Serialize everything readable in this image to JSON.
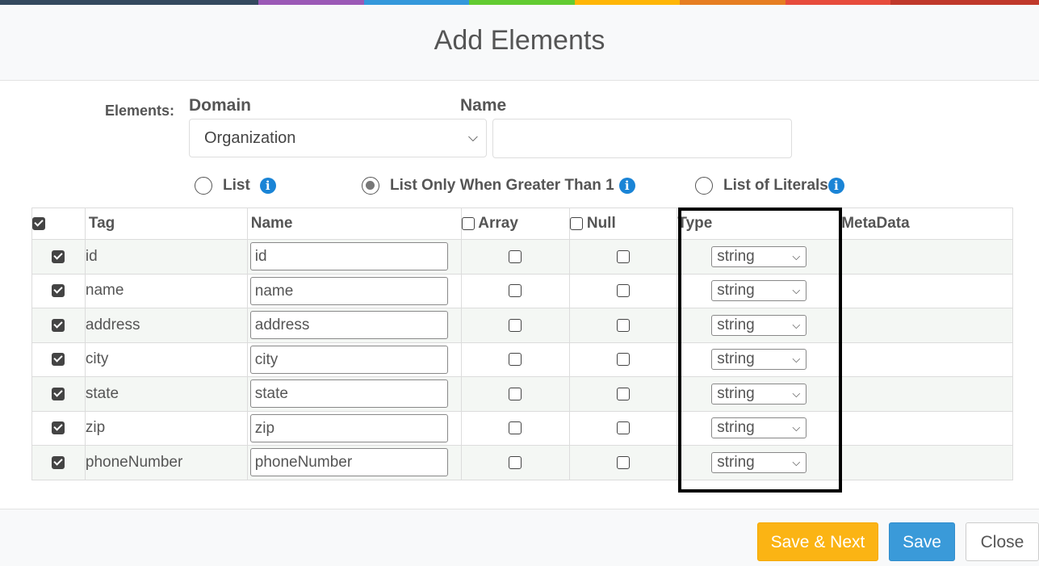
{
  "rainbow_colors": [
    "#34495e",
    "#9b59b6",
    "#3498db",
    "#62cb31",
    "#ffb606",
    "#e67e22",
    "#e74c3c",
    "#c0392b"
  ],
  "header": {
    "title": "Add Elements"
  },
  "form": {
    "elements_label": "Elements:",
    "domain_label": "Domain",
    "name_label": "Name",
    "domain_value": "Organization",
    "name_value": ""
  },
  "radios": {
    "list": "List",
    "list_gt1": "List Only When Greater Than 1",
    "literals": "List of Literals",
    "selected": "list_gt1"
  },
  "table": {
    "headers": {
      "tag": "Tag",
      "name": "Name",
      "array": "Array",
      "null": "Null",
      "type": "Type",
      "metadata": "MetaData"
    },
    "rows": [
      {
        "tag": "id",
        "name": "id",
        "type": "string"
      },
      {
        "tag": "name",
        "name": "name",
        "type": "string"
      },
      {
        "tag": "address",
        "name": "address",
        "type": "string"
      },
      {
        "tag": "city",
        "name": "city",
        "type": "string"
      },
      {
        "tag": "state",
        "name": "state",
        "type": "string"
      },
      {
        "tag": "zip",
        "name": "zip",
        "type": "string"
      },
      {
        "tag": "phoneNumber",
        "name": "phoneNumber",
        "type": "string"
      }
    ]
  },
  "footer": {
    "save_next": "Save & Next",
    "save": "Save",
    "close": "Close"
  }
}
